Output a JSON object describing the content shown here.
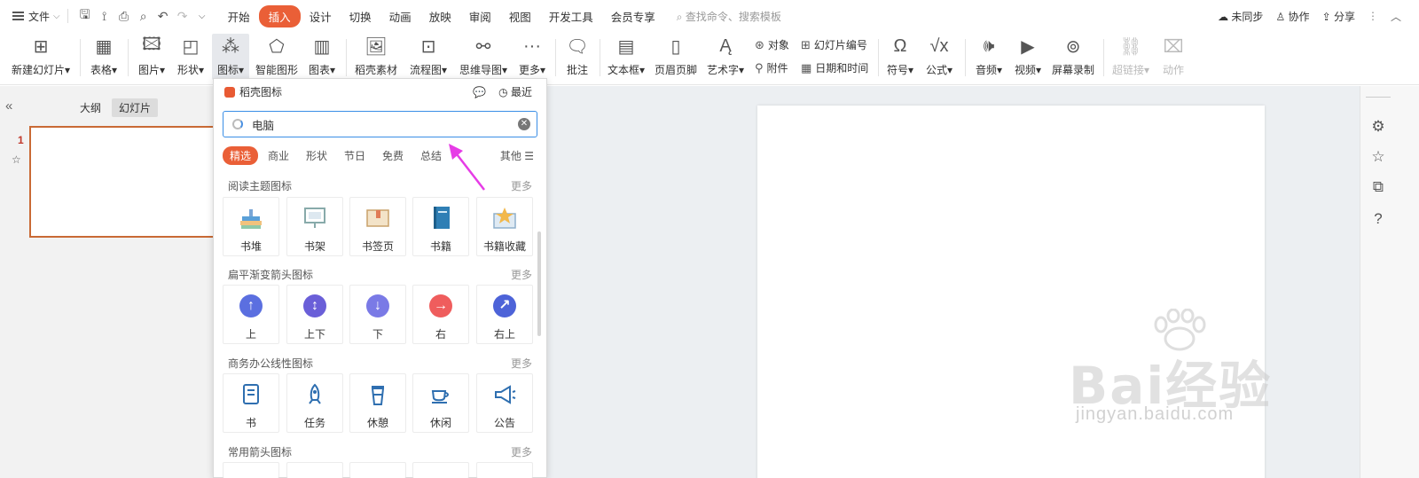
{
  "menubar": {
    "file_label": "文件",
    "tabs": [
      "开始",
      "插入",
      "设计",
      "切换",
      "动画",
      "放映",
      "审阅",
      "视图",
      "开发工具",
      "会员专享"
    ],
    "active_tab": "插入",
    "search_placeholder": "查找命令、搜索模板",
    "right": {
      "sync": "未同步",
      "collab": "协作",
      "share": "分享"
    }
  },
  "ribbon": {
    "new_slide": "新建幻灯片",
    "table": "表格",
    "picture": "图片",
    "shape": "形状",
    "icon": "图标",
    "smartart": "智能图形",
    "chart": "图表",
    "daoke": "稻壳素材",
    "flowchart": "流程图",
    "mindmap": "思维导图",
    "more": "更多",
    "comment": "批注",
    "textbox": "文本框",
    "header_footer": "页眉页脚",
    "wordart": "艺术字",
    "object": "对象",
    "attachment": "附件",
    "slide_number": "幻灯片编号",
    "datetime": "日期和时间",
    "symbol": "符号",
    "formula": "公式",
    "audio": "音频",
    "video": "视频",
    "screen_record": "屏幕录制",
    "hyperlink": "超链接",
    "action": "动作"
  },
  "leftpane": {
    "tab_outline": "大纲",
    "tab_slides": "幻灯片",
    "slide_number": "1"
  },
  "panel": {
    "title": "稻壳图标",
    "recent": "最近",
    "search_value": "电脑",
    "filters": [
      "精选",
      "商业",
      "形状",
      "节日",
      "免费",
      "总结"
    ],
    "filter_more": "其他",
    "more": "更多",
    "sections": [
      {
        "title": "阅读主题图标",
        "items": [
          "书堆",
          "书架",
          "书签页",
          "书籍",
          "书籍收藏"
        ]
      },
      {
        "title": "扁平渐变箭头图标",
        "items": [
          "上",
          "上下",
          "下",
          "右",
          "右上"
        ]
      },
      {
        "title": "商务办公线性图标",
        "items": [
          "书",
          "任务",
          "休憩",
          "休闲",
          "公告"
        ]
      },
      {
        "title": "常用箭头图标",
        "items": []
      }
    ]
  },
  "watermark": {
    "text": "Bai经验",
    "url": "jingyan.baidu.com"
  },
  "colors": {
    "accent": "#ea5f37",
    "search_border": "#3a8ee6",
    "annotation_arrow": "#e63ce6"
  }
}
